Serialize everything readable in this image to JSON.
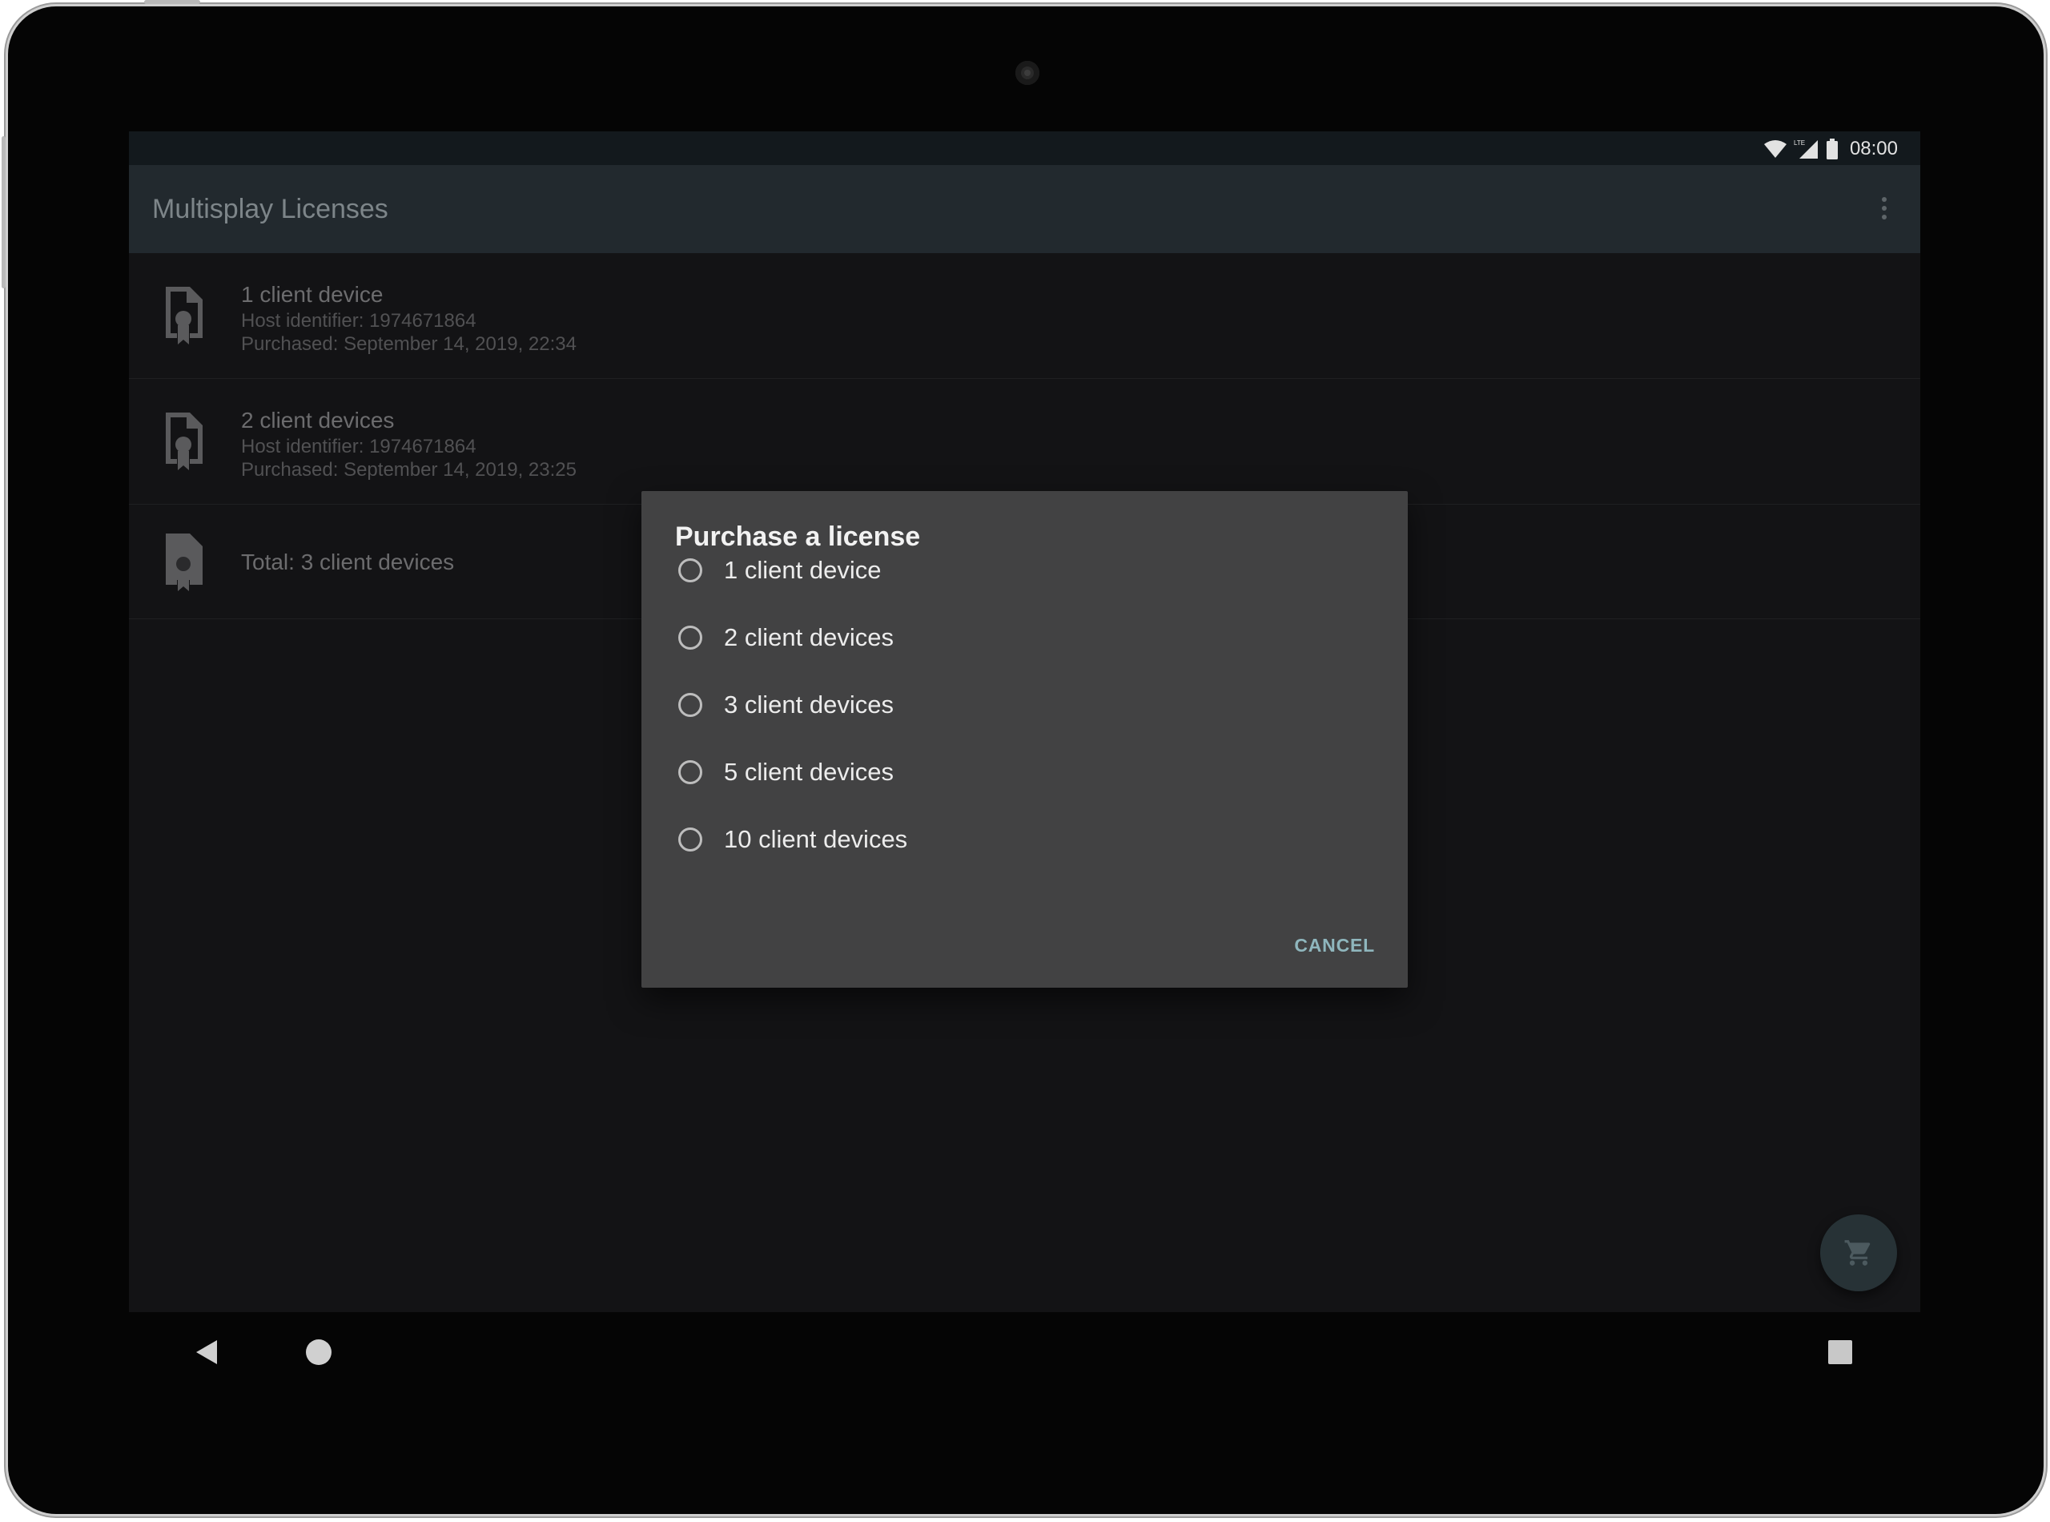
{
  "status_bar": {
    "time": "08:00",
    "network_label": "LTE"
  },
  "app_bar": {
    "title": "Multisplay Licenses"
  },
  "licenses": [
    {
      "title": "1 client device",
      "host": "Host identifier: 1974671864",
      "purchased": "Purchased: September 14, 2019, 22:34"
    },
    {
      "title": "2 client devices",
      "host": "Host identifier: 1974671864",
      "purchased": "Purchased: September 14, 2019, 23:25"
    }
  ],
  "total": "Total: 3 client devices",
  "dialog": {
    "title": "Purchase a license",
    "options": [
      "1 client device",
      "2 client devices",
      "3 client devices",
      "5 client devices",
      "10 client devices"
    ],
    "cancel_label": "CANCEL"
  },
  "icons": {
    "license": "license-certificate-icon",
    "fab": "shopping-cart-icon",
    "overflow": "more-vert-icon"
  },
  "colors": {
    "app_bar": "#22292e",
    "dialog_bg": "#424243",
    "accent": "#8fb6bd",
    "screen_bg": "#131315"
  }
}
